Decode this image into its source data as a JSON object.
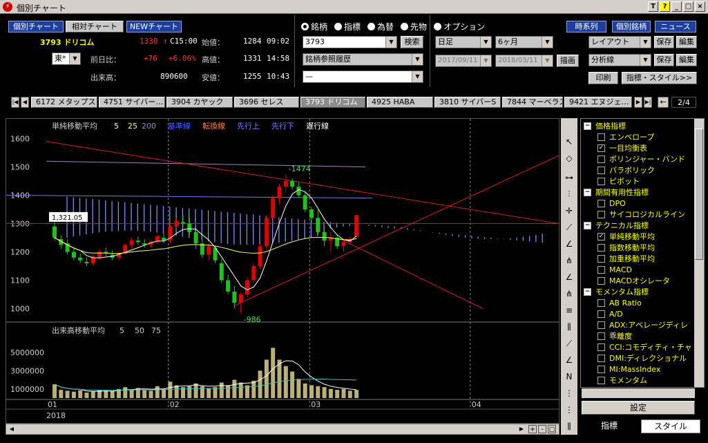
{
  "window": {
    "title": "個別チャート",
    "app_icon": "lightning-icon"
  },
  "header_tabs": {
    "individual": "個別チャート",
    "relative": "相対チャート",
    "new": "NEWチャート"
  },
  "stock": {
    "code_name": "3793 ドリコム",
    "price": "1330",
    "arrow": "↑",
    "time": "C15:00",
    "open_label": "始値：",
    "open_value": "1284",
    "open_time": "09:02",
    "change_label": "前日比：",
    "change_value": "+76",
    "change_pct": "+6.06%",
    "high_label": "高値：",
    "high_value": "1331",
    "high_time": "14:58",
    "volume_label": "出来高：",
    "volume_value": "890600",
    "low_label": "安値：",
    "low_value": "1255",
    "low_time": "10:43",
    "market": "東*"
  },
  "radio": {
    "items": [
      "銘柄",
      "指標",
      "為替",
      "先物",
      "オプション"
    ],
    "selected": 0
  },
  "inputs": {
    "code": "3793",
    "search_btn": "検索",
    "history": "銘柄参照履歴",
    "blank": "—",
    "period": "日足",
    "range": "6ヶ月",
    "from_date": "2017/09/11",
    "to_date": "2018/03/11",
    "draw_btn": "描画"
  },
  "right_buttons": {
    "timeseries": "時系列",
    "individual_stock": "個別銘柄",
    "news": "ニュース",
    "layout": "レイアウト",
    "save1": "保存",
    "edit1": "編集",
    "analysis": "分析線",
    "save2": "保存",
    "edit2": "編集",
    "print": "印刷",
    "style": "指標・スタイル>>"
  },
  "stock_tabs": [
    "6172 メタップス",
    "4751 サイバー…",
    "3904 カヤック",
    "3696 セレス",
    "3793 ドリコム",
    "4925 HABA",
    "3810 サイバーS",
    "7844 マーベラス",
    "9421 エヌジェ…"
  ],
  "active_tab": 4,
  "page_indicator": "2/4",
  "legend": {
    "sma_label": "単純移動平均",
    "sma5": "5",
    "sma25": "25",
    "sma200": "200",
    "kijun": "基準線",
    "tenkan": "転換線",
    "senko_up": "先行上",
    "senko_down": "先行下",
    "chikou": "遅行線",
    "vol_label": "出来高移動平均",
    "v5": "5",
    "v50": "50",
    "v75": "75"
  },
  "annotations": {
    "high": "-1474",
    "low": "-986",
    "cursor_price": "1,321.05"
  },
  "month_labels": [
    "01",
    "02",
    "03",
    "04"
  ],
  "year_label": "2018",
  "colors": {
    "up": "#e00000",
    "down": "#20c020",
    "sma5": "#ffffff",
    "sma25": "#ffff60",
    "sma200": "#a080c0",
    "cloud": "#7f8fe8"
  },
  "chart_data": {
    "type": "candlestick",
    "y_ticks": [
      1000,
      1100,
      1200,
      1300,
      1400,
      1500,
      1600
    ],
    "ylim": [
      950,
      1650
    ],
    "volume_ticks": [
      "1000000",
      "3000000",
      "5000000"
    ],
    "volume_ylim": [
      0,
      6500000
    ],
    "candles": [
      [
        1290,
        1330,
        1240,
        1250
      ],
      [
        1245,
        1260,
        1210,
        1225
      ],
      [
        1230,
        1245,
        1190,
        1200
      ],
      [
        1200,
        1215,
        1170,
        1180
      ],
      [
        1180,
        1195,
        1160,
        1170
      ],
      [
        1165,
        1180,
        1150,
        1160
      ],
      [
        1160,
        1190,
        1150,
        1185
      ],
      [
        1180,
        1210,
        1170,
        1200
      ],
      [
        1200,
        1215,
        1185,
        1195
      ],
      [
        1190,
        1205,
        1170,
        1180
      ],
      [
        1180,
        1200,
        1170,
        1195
      ],
      [
        1195,
        1230,
        1190,
        1225
      ],
      [
        1225,
        1250,
        1210,
        1240
      ],
      [
        1240,
        1255,
        1225,
        1235
      ],
      [
        1230,
        1245,
        1215,
        1225
      ],
      [
        1225,
        1240,
        1215,
        1235
      ],
      [
        1235,
        1260,
        1225,
        1255
      ],
      [
        1250,
        1265,
        1230,
        1240
      ],
      [
        1240,
        1300,
        1230,
        1290
      ],
      [
        1290,
        1320,
        1280,
        1310
      ],
      [
        1305,
        1330,
        1290,
        1300
      ],
      [
        1300,
        1320,
        1260,
        1270
      ],
      [
        1270,
        1290,
        1210,
        1230
      ],
      [
        1230,
        1245,
        1180,
        1190
      ],
      [
        1190,
        1230,
        1170,
        1220
      ],
      [
        1215,
        1220,
        1160,
        1170
      ],
      [
        1160,
        1175,
        1090,
        1100
      ],
      [
        1100,
        1120,
        1050,
        1060
      ],
      [
        1060,
        1080,
        1000,
        1020
      ],
      [
        1020,
        1060,
        986,
        1050
      ],
      [
        1050,
        1110,
        1040,
        1100
      ],
      [
        1100,
        1160,
        1090,
        1150
      ],
      [
        1150,
        1230,
        1140,
        1220
      ],
      [
        1220,
        1330,
        1210,
        1320
      ],
      [
        1320,
        1400,
        1300,
        1390
      ],
      [
        1390,
        1440,
        1370,
        1430
      ],
      [
        1430,
        1474,
        1410,
        1450
      ],
      [
        1450,
        1460,
        1420,
        1430
      ],
      [
        1430,
        1445,
        1390,
        1400
      ],
      [
        1400,
        1410,
        1340,
        1350
      ],
      [
        1350,
        1360,
        1300,
        1320
      ],
      [
        1320,
        1350,
        1260,
        1270
      ],
      [
        1270,
        1290,
        1220,
        1240
      ],
      [
        1240,
        1270,
        1200,
        1250
      ],
      [
        1250,
        1260,
        1210,
        1220
      ],
      [
        1220,
        1240,
        1200,
        1235
      ],
      [
        1235,
        1255,
        1225,
        1245
      ],
      [
        1254,
        1331,
        1255,
        1330
      ]
    ],
    "volumes": [
      1500000,
      900000,
      800000,
      700000,
      850000,
      600000,
      700000,
      900000,
      800000,
      750000,
      1000000,
      1200000,
      900000,
      1100000,
      850000,
      800000,
      1300000,
      1000000,
      1800000,
      1400000,
      1200000,
      1300000,
      1600000,
      1300000,
      1100000,
      1200000,
      1700000,
      1400000,
      2000000,
      1700000,
      1400000,
      1900000,
      3000000,
      4200000,
      5500000,
      4200000,
      3500000,
      2900000,
      2100000,
      1600000,
      1400000,
      1300000,
      1200000,
      1000000,
      900000,
      1000000,
      800000,
      890600
    ]
  },
  "indicators": [
    {
      "label": "価格指標",
      "group": true
    },
    {
      "label": "エンベロープ",
      "checked": false
    },
    {
      "label": "一目均衡表",
      "checked": true
    },
    {
      "label": "ボリンジャー・バンド",
      "checked": false
    },
    {
      "label": "パラボリック",
      "checked": false
    },
    {
      "label": "ピボット",
      "checked": false
    },
    {
      "label": "期間有用性指標",
      "group": true
    },
    {
      "label": "DPO",
      "checked": false
    },
    {
      "label": "サイコロジカルライン",
      "checked": false
    },
    {
      "label": "テクニカル指標",
      "group": true
    },
    {
      "label": "単純移動平均",
      "checked": true
    },
    {
      "label": "指数移動平均",
      "checked": false
    },
    {
      "label": "加重移動平均",
      "checked": false
    },
    {
      "label": "MACD",
      "checked": false
    },
    {
      "label": "MACDオシレータ",
      "checked": false
    },
    {
      "label": "モメンタム指標",
      "group": true
    },
    {
      "label": "AB Ratio",
      "checked": false
    },
    {
      "label": "A/D",
      "checked": false
    },
    {
      "label": "ADX:アベレージディレ",
      "checked": false
    },
    {
      "label": "乖離度",
      "checked": false
    },
    {
      "label": "CCI:コモディティ・チャ",
      "checked": false
    },
    {
      "label": "DMI:ディレクショナル",
      "checked": false
    },
    {
      "label": "MI:MassIndex",
      "checked": false
    },
    {
      "label": "モメンタム",
      "checked": false
    }
  ],
  "settings_btn": "設定",
  "bottom_tabs": {
    "indicator": "指標",
    "style": "スタイル"
  }
}
